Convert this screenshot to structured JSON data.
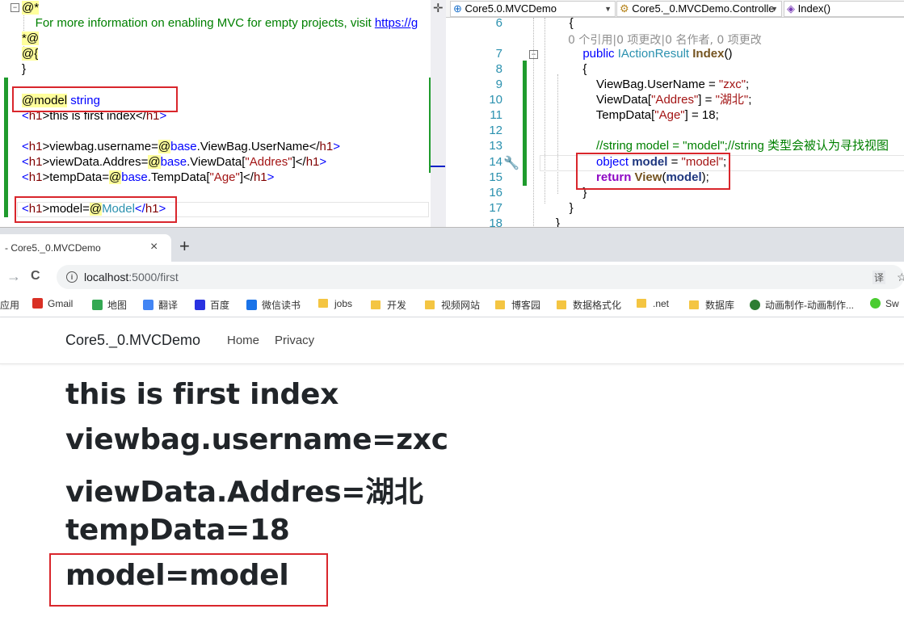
{
  "left_editor": {
    "lines": [
      {
        "parts": [
          [
            "@*",
            "razor"
          ]
        ]
      },
      {
        "parts": [
          [
            "    For more information on enabling MVC for empty projects, visit ",
            "green"
          ],
          [
            "https://g",
            "link"
          ]
        ]
      },
      {
        "parts": [
          [
            "*@",
            "razor"
          ]
        ]
      },
      {
        "parts": [
          [
            "@{",
            "razor"
          ]
        ]
      },
      {
        "parts": [
          [
            "}",
            "plain"
          ]
        ]
      },
      {
        "parts": [
          [
            "",
            "plain"
          ]
        ]
      },
      {
        "parts": [
          [
            "@model",
            "razor"
          ],
          [
            " string",
            "blue"
          ]
        ]
      },
      {
        "parts": [
          [
            "<",
            "blue"
          ],
          [
            "h1",
            "maroon"
          ],
          [
            ">this is first index</",
            "plain"
          ],
          [
            "h1",
            "maroon"
          ],
          [
            ">",
            "blue"
          ]
        ]
      },
      {
        "parts": [
          [
            "",
            "plain"
          ]
        ]
      },
      {
        "parts": [
          [
            "<",
            "blue"
          ],
          [
            "h1",
            "maroon"
          ],
          [
            ">viewbag.username=",
            "plain"
          ],
          [
            "@",
            "razor"
          ],
          [
            "base",
            "blue"
          ],
          [
            ".ViewBag.UserName</",
            "plain"
          ],
          [
            "h1",
            "maroon"
          ],
          [
            ">",
            "blue"
          ]
        ]
      },
      {
        "parts": [
          [
            "<",
            "blue"
          ],
          [
            "h1",
            "maroon"
          ],
          [
            ">viewData.Addres=",
            "plain"
          ],
          [
            "@",
            "razor"
          ],
          [
            "base",
            "blue"
          ],
          [
            ".ViewData[",
            "plain"
          ],
          [
            "\"Addres\"",
            "red"
          ],
          [
            "]</",
            "plain"
          ],
          [
            "h1",
            "maroon"
          ],
          [
            ">",
            "blue"
          ]
        ]
      },
      {
        "parts": [
          [
            "<",
            "blue"
          ],
          [
            "h1",
            "maroon"
          ],
          [
            ">tempData=",
            "plain"
          ],
          [
            "@",
            "razor"
          ],
          [
            "base",
            "blue"
          ],
          [
            ".TempData[",
            "plain"
          ],
          [
            "\"Age\"",
            "red"
          ],
          [
            "]</",
            "plain"
          ],
          [
            "h1",
            "maroon"
          ],
          [
            ">",
            "blue"
          ]
        ]
      },
      {
        "parts": [
          [
            "",
            "plain"
          ]
        ]
      },
      {
        "parts": [
          [
            "<",
            "blue"
          ],
          [
            "h1",
            "maroon"
          ],
          [
            ">model=",
            "plain"
          ],
          [
            "@",
            "razor"
          ],
          [
            "Model",
            "type"
          ],
          [
            "</",
            "blue"
          ],
          [
            "h1",
            "maroon"
          ],
          [
            ">",
            "blue"
          ]
        ]
      }
    ]
  },
  "right_editor": {
    "dropdowns": [
      "Core5.0.MVCDemo",
      "Core5._0.MVCDemo.Controlle",
      "Index()"
    ],
    "codelens": "0 个引用|0 项更改|0 名作者, 0 项更改",
    "line_numbers": [
      "6",
      "7",
      "8",
      "9",
      "10",
      "11",
      "12",
      "13",
      "14",
      "15",
      "16",
      "17",
      "18"
    ],
    "lines": [
      {
        "parts": [
          [
            "    {",
            "plain"
          ]
        ]
      },
      {
        "parts": [
          [
            "        ",
            "plain"
          ],
          [
            "public",
            "blue"
          ],
          [
            " ",
            "plain"
          ],
          [
            "IActionResult",
            "type"
          ],
          [
            " ",
            "plain"
          ],
          [
            "Index",
            "method"
          ],
          [
            "()",
            "plain"
          ]
        ]
      },
      {
        "parts": [
          [
            "        {",
            "plain"
          ]
        ]
      },
      {
        "parts": [
          [
            "            ViewBag.UserName = ",
            "plain"
          ],
          [
            "\"zxc\"",
            "red"
          ],
          [
            ";",
            "plain"
          ]
        ]
      },
      {
        "parts": [
          [
            "            ViewData[",
            "plain"
          ],
          [
            "\"Addres\"",
            "red"
          ],
          [
            "] = ",
            "plain"
          ],
          [
            "\"湖北\"",
            "red"
          ],
          [
            ";",
            "plain"
          ]
        ]
      },
      {
        "parts": [
          [
            "            TempData[",
            "plain"
          ],
          [
            "\"Age\"",
            "red"
          ],
          [
            "] = 18;",
            "plain"
          ]
        ]
      },
      {
        "parts": [
          [
            "",
            "plain"
          ]
        ]
      },
      {
        "parts": [
          [
            "            //string model = \"model\";//string 类型会被认为寻找视图",
            "green"
          ]
        ]
      },
      {
        "parts": [
          [
            "            ",
            "plain"
          ],
          [
            "object",
            "blue"
          ],
          [
            " ",
            "plain"
          ],
          [
            "model",
            "bold"
          ],
          [
            " = ",
            "plain"
          ],
          [
            "\"model\"",
            "red"
          ],
          [
            ";",
            "plain"
          ]
        ]
      },
      {
        "parts": [
          [
            "            ",
            "plain"
          ],
          [
            "return",
            "purple"
          ],
          [
            " ",
            "plain"
          ],
          [
            "View",
            "method"
          ],
          [
            "(",
            "plain"
          ],
          [
            "model",
            "bold"
          ],
          [
            ");",
            "plain"
          ]
        ]
      },
      {
        "parts": [
          [
            "        }",
            "plain"
          ]
        ]
      },
      {
        "parts": [
          [
            "    }",
            "plain"
          ]
        ]
      },
      {
        "parts": [
          [
            "}",
            "plain"
          ]
        ]
      }
    ]
  },
  "browser": {
    "tab_title": "- Core5._0.MVCDemo",
    "tab_close": "×",
    "new_tab": "+",
    "back": "→",
    "reload": "C",
    "url_host": "localhost",
    "url_rest": ":5000/first",
    "translate_icon_text": "译",
    "star_icon_text": "☆",
    "bookmarks": [
      {
        "label": "应用",
        "icon": "apps-icon"
      },
      {
        "label": "Gmail",
        "icon": "gmail-icon",
        "color": "#d93025"
      },
      {
        "label": "地图",
        "icon": "maps-icon",
        "color": "#34a853"
      },
      {
        "label": "翻译",
        "icon": "translate-icon",
        "color": "#4285f4"
      },
      {
        "label": "百度",
        "icon": "baidu-icon",
        "color": "#2932e1"
      },
      {
        "label": "微信读书",
        "icon": "weread-icon",
        "color": "#1a73e8"
      },
      {
        "label": "jobs",
        "icon": "folder-icon"
      },
      {
        "label": "开发",
        "icon": "folder-icon"
      },
      {
        "label": "视频网站",
        "icon": "folder-icon"
      },
      {
        "label": "博客园",
        "icon": "folder-icon"
      },
      {
        "label": "数据格式化",
        "icon": "folder-icon"
      },
      {
        "label": ".net",
        "icon": "folder-icon"
      },
      {
        "label": "数据库",
        "icon": "folder-icon"
      },
      {
        "label": "动画制作-动画制作...",
        "icon": "animation-site-icon",
        "color": "#2e7d32"
      },
      {
        "label": "Sw",
        "icon": "swagger-icon",
        "color": "#49cc30"
      }
    ],
    "navbar": {
      "brand": "Core5._0.MVCDemo",
      "links": [
        "Home",
        "Privacy"
      ]
    },
    "headings": [
      "this is first index",
      "viewbag.username=zxc",
      "viewData.Addres=湖北",
      "tempData=18",
      "model=model"
    ]
  },
  "colors": {
    "gutter_green": "#1f9b2d",
    "highlight_red": "#d9262c",
    "razor_yellow": "#ffff9c"
  }
}
